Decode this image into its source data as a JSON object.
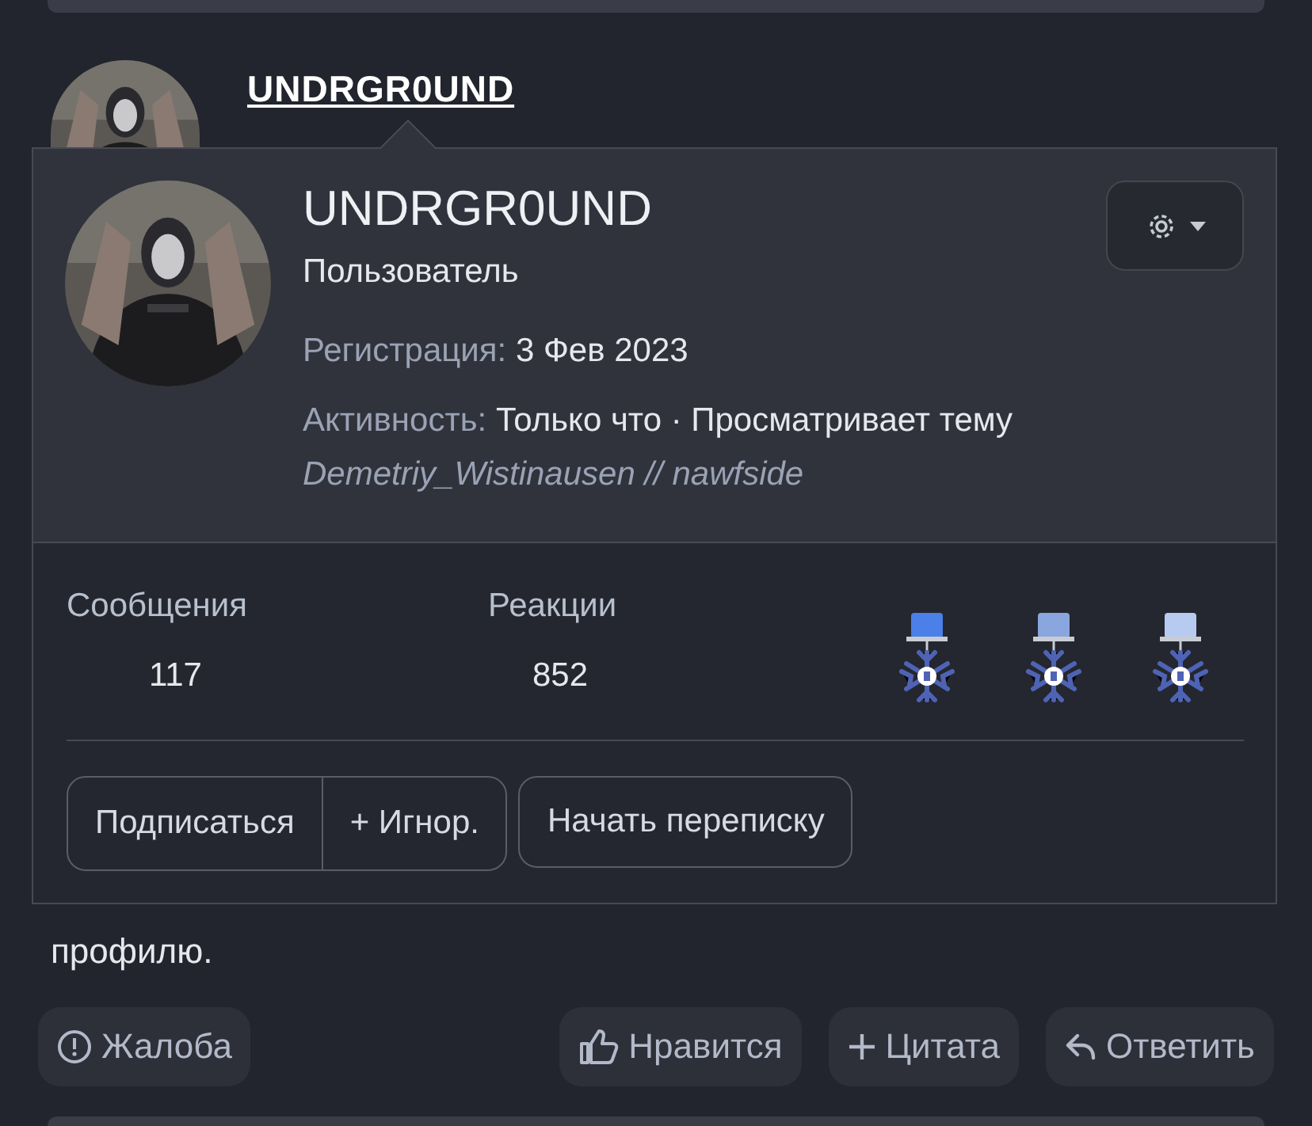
{
  "post": {
    "author": "UNDRGR0UND",
    "message_tail": "профилю.",
    "actions": [
      {
        "kind": "report",
        "label": "Жалоба"
      },
      {
        "kind": "like",
        "label": "Нравится"
      },
      {
        "kind": "quote",
        "label": "Цитата"
      },
      {
        "kind": "reply",
        "label": "Ответить"
      }
    ]
  },
  "profile_card": {
    "name": "UNDRGR0UND",
    "role": "Пользователь",
    "facts": [
      {
        "label": "Регистрация:",
        "value": "3 Фев 2023"
      },
      {
        "label": "Активность:",
        "value": "Только что · Просматривает тему"
      }
    ],
    "custom_title": "Demetriy_Wistinausen // nawfside",
    "stats": [
      {
        "label": "Сообщения",
        "value": "117"
      },
      {
        "label": "Реакции",
        "value": "852"
      }
    ],
    "medals": [
      {
        "color": "#4a80e8"
      },
      {
        "color": "#8aa6de"
      },
      {
        "color": "#b6cbef"
      }
    ],
    "buttons": [
      {
        "kind": "group",
        "label": "Подписаться"
      },
      {
        "kind": "group",
        "label": "+ Игнор."
      },
      {
        "kind": "single",
        "label": "Начать переписку"
      }
    ]
  }
}
